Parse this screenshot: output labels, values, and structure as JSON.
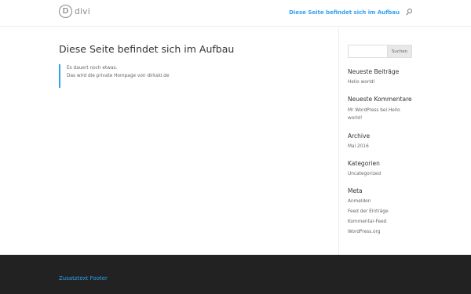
{
  "header": {
    "logo_letter": "D",
    "logo_text": "divi",
    "nav_link": "Diese Seite befindet sich im Aufbau"
  },
  "main": {
    "title": "Diese Seite befindet sich im Aufbau",
    "quote_line1": "Es dauert noch etwas.",
    "quote_line2": "Das wird die private Hompage von dirkski.de"
  },
  "sidebar": {
    "search": {
      "placeholder": "",
      "button": "Suchen"
    },
    "recent_posts": {
      "title": "Neueste Beiträge",
      "items": [
        "Hello world!"
      ]
    },
    "recent_comments": {
      "title": "Neueste Kommentare",
      "author": "Mr WordPress",
      "connector": "bei",
      "post_line1": "Hello",
      "post_line2": "world!"
    },
    "archive": {
      "title": "Archive",
      "items": [
        "Mai 2016"
      ]
    },
    "categories": {
      "title": "Kategorien",
      "items": [
        "Uncategorized"
      ]
    },
    "meta": {
      "title": "Meta",
      "items": [
        "Anmelden",
        "Feed der Einträge",
        "Kommentar-Feed",
        "WordPress.org"
      ]
    }
  },
  "footer": {
    "text": "Zusatztext Footer"
  },
  "colors": {
    "accent": "#2ea3f2",
    "footer_bg": "#222222",
    "title": "#333333",
    "body": "#666666"
  }
}
